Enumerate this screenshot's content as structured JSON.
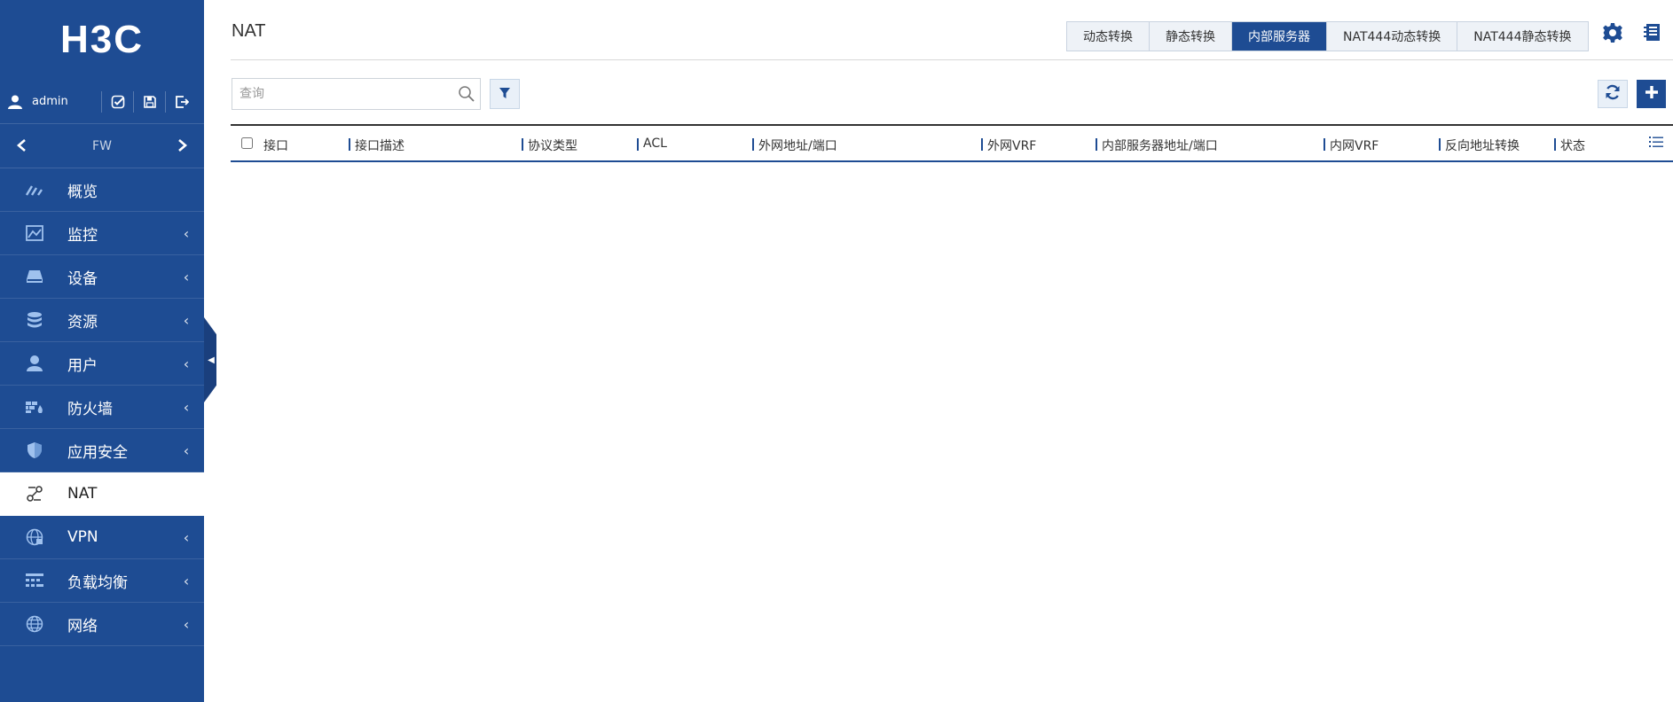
{
  "brand": {
    "logo_text": "H3C"
  },
  "user": {
    "name": "admin"
  },
  "device": {
    "name": "FW"
  },
  "sidebar": {
    "items": [
      {
        "label": "概览",
        "icon": "dashboard-icon",
        "has_submenu": false
      },
      {
        "label": "监控",
        "icon": "monitor-icon",
        "has_submenu": true
      },
      {
        "label": "设备",
        "icon": "device-icon",
        "has_submenu": true
      },
      {
        "label": "资源",
        "icon": "database-icon",
        "has_submenu": true
      },
      {
        "label": "用户",
        "icon": "user-icon",
        "has_submenu": true
      },
      {
        "label": "防火墙",
        "icon": "firewall-icon",
        "has_submenu": true
      },
      {
        "label": "应用安全",
        "icon": "shield-icon",
        "has_submenu": true
      },
      {
        "label": "NAT",
        "icon": "nat-icon",
        "has_submenu": false,
        "active": true
      },
      {
        "label": "VPN",
        "icon": "vpn-globe-icon",
        "has_submenu": true
      },
      {
        "label": "负载均衡",
        "icon": "load-balance-icon",
        "has_submenu": true
      },
      {
        "label": "网络",
        "icon": "network-globe-icon",
        "has_submenu": true
      }
    ]
  },
  "header": {
    "title": "NAT",
    "tabs": [
      {
        "label": "动态转换",
        "active": false
      },
      {
        "label": "静态转换",
        "active": false
      },
      {
        "label": "内部服务器",
        "active": true
      },
      {
        "label": "NAT444动态转换",
        "active": false
      },
      {
        "label": "NAT444静态转换",
        "active": false
      }
    ]
  },
  "search": {
    "placeholder": "查询",
    "value": ""
  },
  "table": {
    "columns": [
      "接口",
      "接口描述",
      "协议类型",
      "ACL",
      "外网地址/端口",
      "外网VRF",
      "内部服务器地址/端口",
      "内网VRF",
      "反向地址转换",
      "状态"
    ],
    "rows": []
  },
  "colors": {
    "primary": "#1e4c93",
    "sidebar_bg": "#1e4c93"
  }
}
